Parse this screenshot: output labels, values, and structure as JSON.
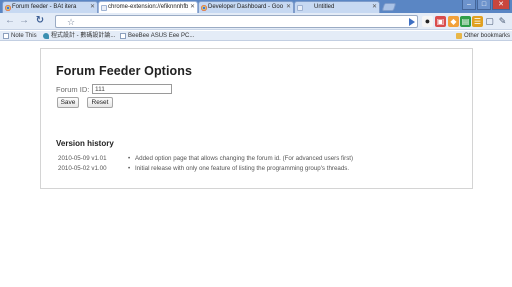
{
  "tabs": [
    {
      "label": "Forum feeder - BAt itera",
      "icon": "chrome-icon"
    },
    {
      "label": "chrome-extension://efiknnnhfb",
      "icon": "blank-page-icon"
    },
    {
      "label": "Developer Dashboard - Goo",
      "icon": "chrome-icon"
    },
    {
      "label": "Untitled",
      "icon": "blank-page-icon"
    }
  ],
  "window_controls": {
    "minimize": "–",
    "maximize": "□",
    "close": "✕"
  },
  "toolbar": {
    "back": "←",
    "forward": "→",
    "reload": "↻",
    "home": "⌂",
    "address": "",
    "extensions": [
      "bomb-icon",
      "pinkish-icon",
      "green-icon",
      "orange-icon",
      "teal-icon"
    ],
    "page_menu": "page-menu-icon",
    "wrench_menu": "wrench-icon"
  },
  "bookmarks": {
    "items": [
      {
        "label": "Note This",
        "icon": "page-icon"
      },
      {
        "label": "程式設計 - 數碼設計論...",
        "icon": "bird-icon"
      },
      {
        "label": "BeeBee ASUS Eee PC...",
        "icon": "page-icon"
      }
    ],
    "other": "Other bookmarks"
  },
  "options": {
    "title": "Forum Feeder Options",
    "forum_id_label": "Forum ID:",
    "forum_id_value": "111",
    "save_label": "Save",
    "reset_label": "Reset"
  },
  "version_history": {
    "heading": "Version history",
    "entries": [
      {
        "date": "2010-05-09 v1.01",
        "description": "Added option page that allows changing the forum id. (For advanced users first)"
      },
      {
        "date": "2010-05-02 v1.00",
        "description": "Initial release with only one feature of listing the programming group's threads."
      }
    ]
  }
}
